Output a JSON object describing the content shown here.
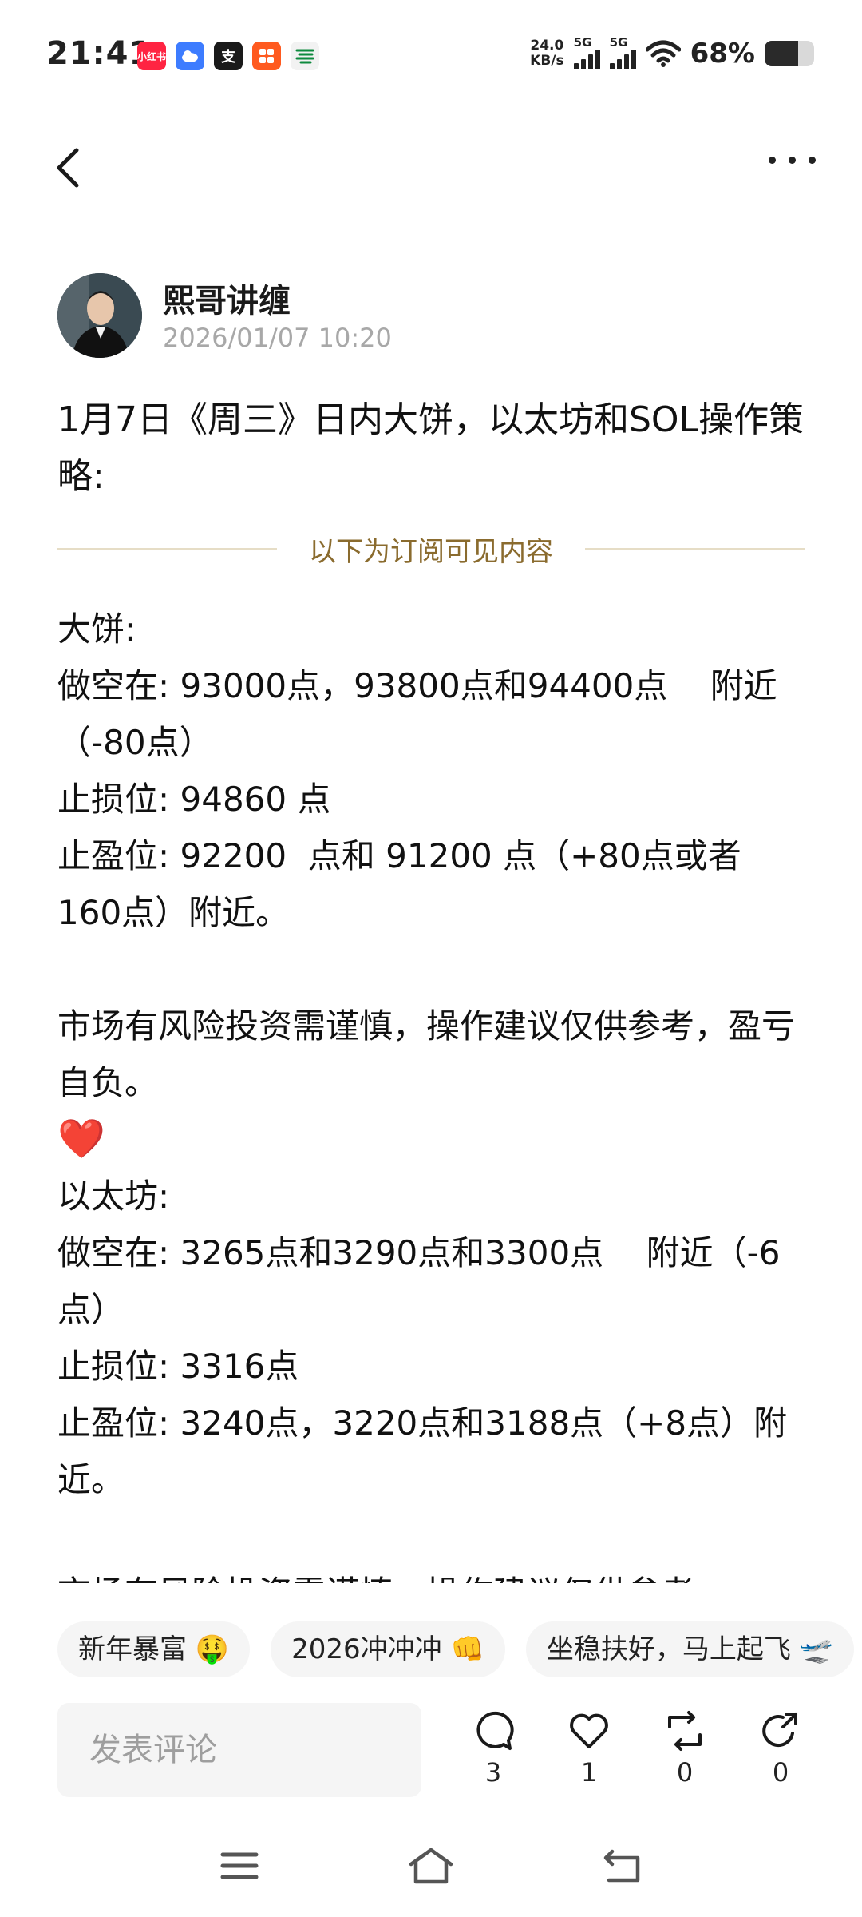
{
  "status_bar": {
    "time": "21:41",
    "net_speed_value": "24.0",
    "net_speed_unit": "KB/s",
    "sim1_label": "5G",
    "sim2_label": "5G",
    "battery_percent": "68%",
    "battery_level": 0.68,
    "notification_icons": [
      "xiaohongshu-icon",
      "cloud-app-icon",
      "alipay-icon",
      "taobao-icon",
      "china-post-icon"
    ],
    "notification_texts": [
      "小红书",
      "",
      "支",
      "",
      ""
    ]
  },
  "header": {
    "back_icon": "back-arrow-icon",
    "more_icon": "more-dots-icon"
  },
  "author": {
    "name": "熙哥讲缠",
    "time": "2026/01/07 10:20"
  },
  "post": {
    "title": "1月7日《周三》日内大饼，以太坊和SOL操作策略:",
    "divider_text": "以下为订阅可见内容",
    "lines": [
      "大饼:",
      "做空在: 93000点，93800点和94400点    附近（-80点）",
      "止损位: 94860 点",
      "止盈位: 92200  点和 91200 点（+80点或者160点）附近。",
      "",
      "市场有风险投资需谨慎，操作建议仅供参考，盈亏自负。",
      "❤️",
      "以太坊:",
      "做空在: 3265点和3290点和3300点    附近（-6点）",
      "止损位: 3316点",
      "止盈位: 3240点，3220点和3188点（+8点）附近。",
      "",
      "市场有风险投资需谨慎，操作建议仅供参考，"
    ]
  },
  "tags": [
    "新年暴富 🤑",
    "2026冲冲冲 👊",
    "坐稳扶好，马上起飞 🛫"
  ],
  "comment_placeholder": "发表评论",
  "actions": {
    "comment_count": "3",
    "like_count": "1",
    "repost_count": "0",
    "share_count": "0"
  },
  "nav": {
    "menu_icon": "menu-icon",
    "home_icon": "home-icon",
    "back_icon": "nav-back-icon"
  }
}
